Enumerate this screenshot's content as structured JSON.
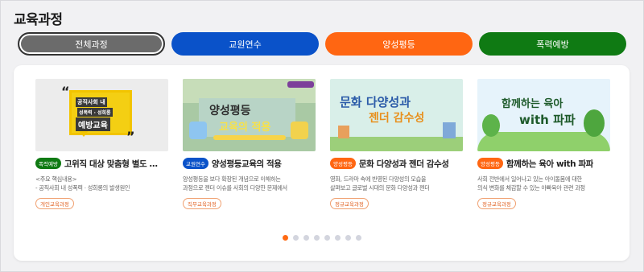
{
  "section_title": "교육과정",
  "tabs": [
    {
      "label": "전체과정",
      "color": "#6b6b6b",
      "active": true
    },
    {
      "label": "교원연수",
      "color": "#0a52c9"
    },
    {
      "label": "양성평등",
      "color": "#ff6612"
    },
    {
      "label": "폭력예방",
      "color": "#0f7a13"
    }
  ],
  "cards": [
    {
      "badge": "폭력예방",
      "badge_color": "#0f7a13",
      "title": "고위직 대상 맞춤형 별도 …",
      "desc": [
        "<주요 핵심내용>",
        "- 공직사회 내 성폭력 · 성희롱의 발생원인"
      ],
      "tag": "개인교육과정",
      "thumb": {
        "line1": "공직사회 내",
        "line2": "성폭력 · 성희롱",
        "line3": "예방교육"
      }
    },
    {
      "badge": "교원연수",
      "badge_color": "#0a52c9",
      "title": "양성평등교육의 적용",
      "desc": [
        "양성평등을 보다 확장된 개념으로 이해하는",
        "과정으로 젠더 이슈를 사회의 다양한 문제에서"
      ],
      "tag": "직무교육과정",
      "thumb": {
        "line1": "양성평등",
        "line2": "교육의 적용"
      }
    },
    {
      "badge": "양성평등",
      "badge_color": "#ff6612",
      "title": "문화 다양성과 젠더 감수성",
      "desc": [
        "영화, 드라마 속에 반영된 다양성의 모습을",
        "살펴보고 글로벌 시대의 문화 다양성과 젠더"
      ],
      "tag": "정규교육과정",
      "thumb": {
        "line1": "문화 다양성과",
        "line2": "젠더 감수성"
      }
    },
    {
      "badge": "양성평등",
      "badge_color": "#ff6612",
      "title": "함께하는 육아 with 파파",
      "desc": [
        "사회 전반에서 일어나고 있는 아이돌봄에 대한",
        "의식 변화를 체감할 수 있는 아빠육아 관련 과정"
      ],
      "tag": "정규교육과정",
      "thumb": {
        "line1": "함께하는 육아",
        "line2": "with 파파"
      }
    }
  ],
  "pagination": {
    "count": 8,
    "active_index": 0
  }
}
